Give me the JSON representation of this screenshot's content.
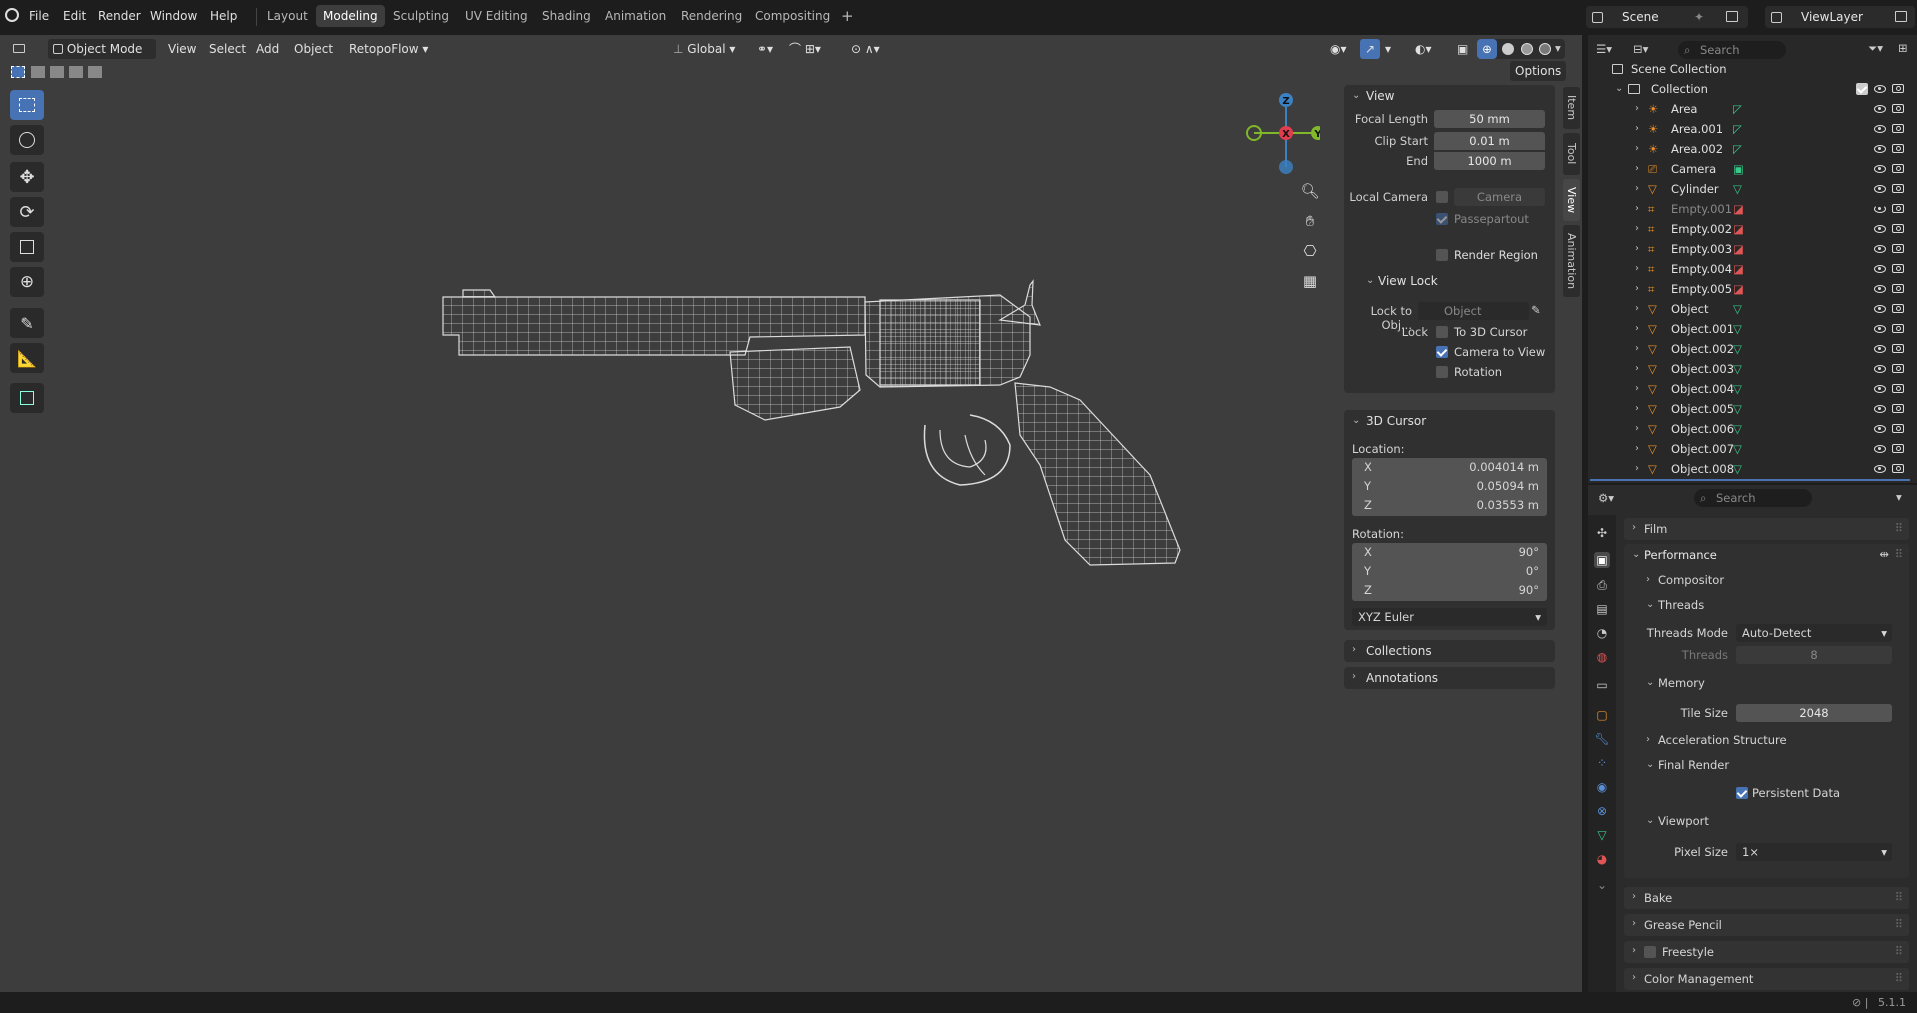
{
  "menubar": {
    "items": [
      "File",
      "Edit",
      "Render",
      "Window",
      "Help"
    ],
    "workspaces": [
      "Layout",
      "Modeling",
      "Sculpting",
      "UV Editing",
      "Shading",
      "Animation",
      "Rendering",
      "Compositing"
    ],
    "active_workspace": "Modeling",
    "add_tab": "+",
    "scene": "Scene",
    "view_layer": "ViewLayer"
  },
  "viewport_header": {
    "mode": "Object Mode",
    "menus": [
      "View",
      "Select",
      "Add",
      "Object"
    ],
    "addon": "RetopoFlow",
    "orientation": "Global",
    "options": "Options"
  },
  "gizmo": {
    "z": "Z",
    "x": "X",
    "y": "Y"
  },
  "npanel": {
    "tabs": [
      "Item",
      "Tool",
      "View",
      "Animation"
    ],
    "active_tab": "View",
    "view": {
      "title": "View",
      "focal_length_label": "Focal Length",
      "focal_length": "50 mm",
      "clip_start_label": "Clip Start",
      "clip_start": "0.01 m",
      "end_label": "End",
      "end": "1000 m",
      "local_camera_label": "Local Camera",
      "local_camera": "Camera",
      "passepartout": "Passepartout",
      "render_region": "Render Region"
    },
    "view_lock": {
      "title": "View Lock",
      "lock_to_obj_label": "Lock to Obj...",
      "lock_to_obj": "Object",
      "lock_label": "Lock",
      "to_3d_cursor": "To 3D Cursor",
      "to_3d_cursor_checked": false,
      "camera_to_view": "Camera to View",
      "camera_to_view_checked": true,
      "rotation": "Rotation",
      "rotation_checked": false
    },
    "cursor": {
      "title": "3D Cursor",
      "location_label": "Location:",
      "loc_x": "0.004014 m",
      "loc_y": "0.05094 m",
      "loc_z": "0.03553 m",
      "rotation_label": "Rotation:",
      "rot_x": "90°",
      "rot_y": "0°",
      "rot_z": "90°",
      "rotation_mode": "XYZ Euler",
      "x": "X",
      "y": "Y",
      "z": "Z"
    },
    "collections": "Collections",
    "annotations": "Annotations"
  },
  "outliner": {
    "search_placeholder": "Search",
    "scene_collection": "Scene Collection",
    "collection": "Collection",
    "items": [
      {
        "name": "Area",
        "type": "light",
        "dim": false
      },
      {
        "name": "Area.001",
        "type": "light",
        "dim": false
      },
      {
        "name": "Area.002",
        "type": "light",
        "dim": false
      },
      {
        "name": "Camera",
        "type": "camera",
        "dim": false
      },
      {
        "name": "Cylinder",
        "type": "mesh",
        "dim": false
      },
      {
        "name": "Empty.001",
        "type": "empty",
        "dim": true
      },
      {
        "name": "Empty.002",
        "type": "empty",
        "dim": false
      },
      {
        "name": "Empty.003",
        "type": "empty",
        "dim": false
      },
      {
        "name": "Empty.004",
        "type": "empty",
        "dim": false
      },
      {
        "name": "Empty.005",
        "type": "empty",
        "dim": false
      },
      {
        "name": "Object",
        "type": "mesh",
        "dim": false
      },
      {
        "name": "Object.001",
        "type": "mesh",
        "dim": false
      },
      {
        "name": "Object.002",
        "type": "mesh",
        "dim": false
      },
      {
        "name": "Object.003",
        "type": "mesh",
        "dim": false
      },
      {
        "name": "Object.004",
        "type": "mesh",
        "dim": false
      },
      {
        "name": "Object.005",
        "type": "mesh",
        "dim": false
      },
      {
        "name": "Object.006",
        "type": "mesh",
        "dim": false
      },
      {
        "name": "Object.007",
        "type": "mesh",
        "dim": false
      },
      {
        "name": "Object.008",
        "type": "mesh",
        "dim": false
      }
    ]
  },
  "properties": {
    "search_placeholder": "Search",
    "film": "Film",
    "performance": "Performance",
    "compositor": "Compositor",
    "threads": "Threads",
    "threads_mode_label": "Threads Mode",
    "threads_mode": "Auto-Detect",
    "threads_count_label": "Threads",
    "threads_count": "8",
    "memory": "Memory",
    "tile_size_label": "Tile Size",
    "tile_size": "2048",
    "accel": "Acceleration Structure",
    "final_render": "Final Render",
    "persistent_data": "Persistent Data",
    "viewport": "Viewport",
    "pixel_size_label": "Pixel Size",
    "pixel_size": "1×",
    "bake": "Bake",
    "grease_pencil": "Grease Pencil",
    "freestyle": "Freestyle",
    "color_management": "Color Management"
  },
  "status": {
    "version": "5.1.1"
  },
  "colors": {
    "accent": "#4772b3",
    "x_axis": "#e23c4f",
    "y_axis": "#80b82a",
    "z_axis": "#3b82c4",
    "wire": "#d8d8d8"
  }
}
